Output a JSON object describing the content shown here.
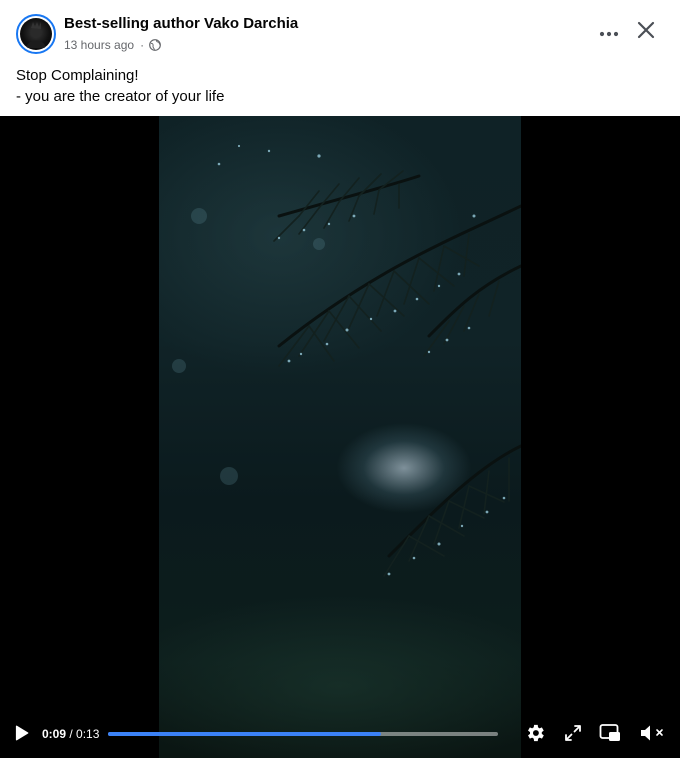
{
  "post": {
    "author": "Best-selling author Vako Darchia",
    "timestamp": "13 hours ago",
    "separator": "·",
    "privacy_icon": "globe-icon",
    "caption_lines": [
      "Stop Complaining!",
      "- you are the creator of your life"
    ]
  },
  "header_actions": {
    "more_icon": "more-horizontal-icon",
    "close_icon": "close-icon"
  },
  "video": {
    "current_time": "0:09",
    "time_separator": " / ",
    "duration": "0:13",
    "progress_fraction": 0.7,
    "progress_color": "#3b82f6",
    "controls": [
      "play-icon",
      "settings-icon",
      "fullscreen-icon",
      "picture-in-picture-icon",
      "volume-muted-icon"
    ]
  },
  "colors": {
    "accent": "#1877f2",
    "text_primary": "#050505",
    "text_secondary": "#65676b"
  }
}
